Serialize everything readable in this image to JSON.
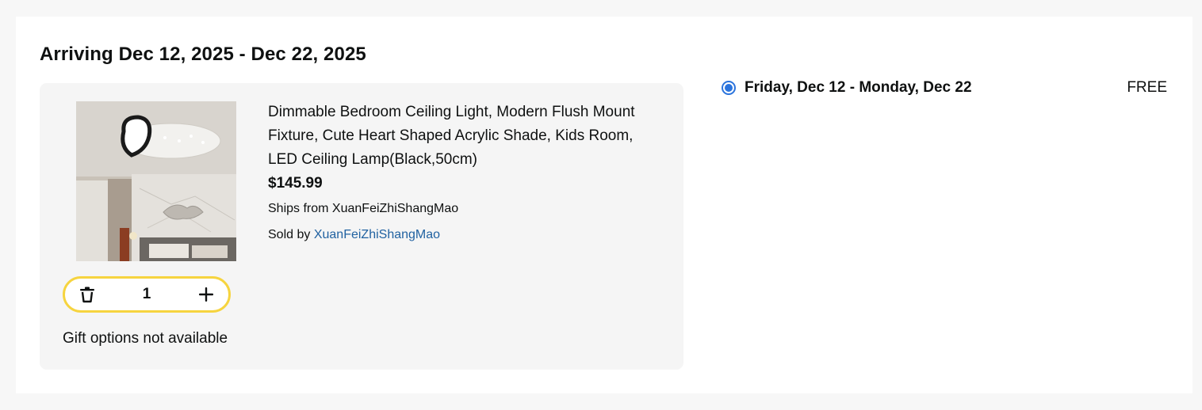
{
  "delivery_group": {
    "heading": "Arriving Dec 12, 2025 - Dec 22, 2025"
  },
  "item": {
    "title": "Dimmable Bedroom Ceiling Light, Modern Flush Mount Fixture, Cute Heart Shaped Acrylic Shade, Kids Room, LED Ceiling Lamp(Black,50cm)",
    "price": "$145.99",
    "ships_from_label": "Ships from",
    "ships_from_value": "XuanFeiZhiShangMao",
    "sold_by_label": "Sold by",
    "sold_by_value": "XuanFeiZhiShangMao",
    "image_icon": "product-photo-ceiling-light",
    "quantity": "1",
    "delete_icon": "trash-icon",
    "increment_icon": "plus-icon",
    "gift_text": "Gift options not available"
  },
  "delivery_option": {
    "label": "Friday, Dec 12 - Monday, Dec 22",
    "price": "FREE",
    "selected": true
  },
  "colors": {
    "link": "#2162a1",
    "stepper_border": "#f6d43f",
    "radio": "#2b74dd",
    "item_box_bg": "#f5f5f5",
    "page_bg": "#f7f7f7"
  }
}
